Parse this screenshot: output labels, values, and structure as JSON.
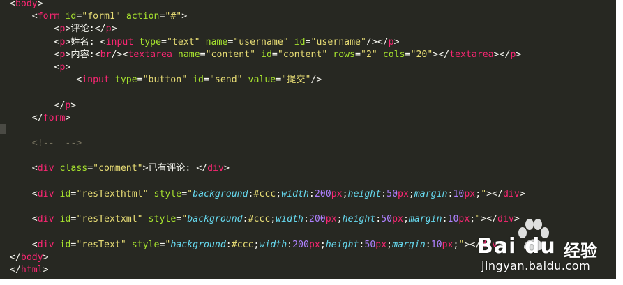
{
  "code_lines": [
    [
      {
        "t": "br",
        "v": "<"
      },
      {
        "t": "tag",
        "v": "body"
      },
      {
        "t": "br",
        "v": ">"
      }
    ],
    [
      {
        "t": "txt",
        "v": "    "
      },
      {
        "t": "br",
        "v": "<"
      },
      {
        "t": "tag",
        "v": "form"
      },
      {
        "t": "txt",
        "v": " "
      },
      {
        "t": "attr",
        "v": "id"
      },
      {
        "t": "txt",
        "v": "="
      },
      {
        "t": "str",
        "v": "\"form1\""
      },
      {
        "t": "txt",
        "v": " "
      },
      {
        "t": "attr",
        "v": "action"
      },
      {
        "t": "txt",
        "v": "="
      },
      {
        "t": "str",
        "v": "\"#\""
      },
      {
        "t": "br",
        "v": ">"
      }
    ],
    [
      {
        "t": "txt",
        "v": "        "
      },
      {
        "t": "br",
        "v": "<"
      },
      {
        "t": "tag",
        "v": "p"
      },
      {
        "t": "br",
        "v": ">"
      },
      {
        "t": "txt",
        "v": "评论:"
      },
      {
        "t": "br",
        "v": "</"
      },
      {
        "t": "tag",
        "v": "p"
      },
      {
        "t": "br",
        "v": ">"
      }
    ],
    [
      {
        "t": "txt",
        "v": "        "
      },
      {
        "t": "br",
        "v": "<"
      },
      {
        "t": "tag",
        "v": "p"
      },
      {
        "t": "br",
        "v": ">"
      },
      {
        "t": "txt",
        "v": "姓名: "
      },
      {
        "t": "br",
        "v": "<"
      },
      {
        "t": "tag",
        "v": "input"
      },
      {
        "t": "txt",
        "v": " "
      },
      {
        "t": "attr",
        "v": "type"
      },
      {
        "t": "txt",
        "v": "="
      },
      {
        "t": "str",
        "v": "\"text\""
      },
      {
        "t": "txt",
        "v": " "
      },
      {
        "t": "attr",
        "v": "name"
      },
      {
        "t": "txt",
        "v": "="
      },
      {
        "t": "str",
        "v": "\"username\""
      },
      {
        "t": "txt",
        "v": " "
      },
      {
        "t": "attr",
        "v": "id"
      },
      {
        "t": "txt",
        "v": "="
      },
      {
        "t": "str",
        "v": "\"username\""
      },
      {
        "t": "br",
        "v": "/></"
      },
      {
        "t": "tag",
        "v": "p"
      },
      {
        "t": "br",
        "v": ">"
      }
    ],
    [
      {
        "t": "txt",
        "v": "        "
      },
      {
        "t": "br",
        "v": "<"
      },
      {
        "t": "tag",
        "v": "p"
      },
      {
        "t": "br",
        "v": ">"
      },
      {
        "t": "txt",
        "v": "内容:"
      },
      {
        "t": "br",
        "v": "<"
      },
      {
        "t": "tag",
        "v": "br"
      },
      {
        "t": "br",
        "v": "/><"
      },
      {
        "t": "tag",
        "v": "textarea"
      },
      {
        "t": "txt",
        "v": " "
      },
      {
        "t": "attr",
        "v": "name"
      },
      {
        "t": "txt",
        "v": "="
      },
      {
        "t": "str",
        "v": "\"content\""
      },
      {
        "t": "txt",
        "v": " "
      },
      {
        "t": "attr",
        "v": "id"
      },
      {
        "t": "txt",
        "v": "="
      },
      {
        "t": "str",
        "v": "\"content\""
      },
      {
        "t": "txt",
        "v": " "
      },
      {
        "t": "attr",
        "v": "rows"
      },
      {
        "t": "txt",
        "v": "="
      },
      {
        "t": "str",
        "v": "\"2\""
      },
      {
        "t": "txt",
        "v": " "
      },
      {
        "t": "attr",
        "v": "cols"
      },
      {
        "t": "txt",
        "v": "="
      },
      {
        "t": "str",
        "v": "\"20\""
      },
      {
        "t": "br",
        "v": "></"
      },
      {
        "t": "tag",
        "v": "textarea"
      },
      {
        "t": "br",
        "v": "></"
      },
      {
        "t": "tag",
        "v": "p"
      },
      {
        "t": "br",
        "v": ">"
      }
    ],
    [
      {
        "t": "txt",
        "v": "        "
      },
      {
        "t": "br",
        "v": "<"
      },
      {
        "t": "tag",
        "v": "p"
      },
      {
        "t": "br",
        "v": ">"
      }
    ],
    [
      {
        "t": "txt",
        "v": "            "
      },
      {
        "t": "br",
        "v": "<"
      },
      {
        "t": "tag",
        "v": "input"
      },
      {
        "t": "txt",
        "v": " "
      },
      {
        "t": "attr",
        "v": "type"
      },
      {
        "t": "txt",
        "v": "="
      },
      {
        "t": "str",
        "v": "\"button\""
      },
      {
        "t": "txt",
        "v": " "
      },
      {
        "t": "attr",
        "v": "id"
      },
      {
        "t": "txt",
        "v": "="
      },
      {
        "t": "str",
        "v": "\"send\""
      },
      {
        "t": "txt",
        "v": " "
      },
      {
        "t": "attr",
        "v": "value"
      },
      {
        "t": "txt",
        "v": "="
      },
      {
        "t": "str",
        "v": "\"提交\""
      },
      {
        "t": "br",
        "v": "/>"
      }
    ],
    [],
    [
      {
        "t": "txt",
        "v": "        "
      },
      {
        "t": "br",
        "v": "</"
      },
      {
        "t": "tag",
        "v": "p"
      },
      {
        "t": "br",
        "v": ">"
      }
    ],
    [
      {
        "t": "txt",
        "v": "    "
      },
      {
        "t": "br",
        "v": "</"
      },
      {
        "t": "tag",
        "v": "form"
      },
      {
        "t": "br",
        "v": ">"
      }
    ],
    [],
    [
      {
        "t": "txt",
        "v": "    "
      },
      {
        "t": "cmt",
        "v": "<!--  -->"
      }
    ],
    [],
    [
      {
        "t": "txt",
        "v": "    "
      },
      {
        "t": "br",
        "v": "<"
      },
      {
        "t": "tag",
        "v": "div"
      },
      {
        "t": "txt",
        "v": " "
      },
      {
        "t": "attr",
        "v": "class"
      },
      {
        "t": "txt",
        "v": "="
      },
      {
        "t": "str",
        "v": "\"comment\""
      },
      {
        "t": "br",
        "v": ">"
      },
      {
        "t": "txt",
        "v": "已有评论: "
      },
      {
        "t": "br",
        "v": "</"
      },
      {
        "t": "tag",
        "v": "div"
      },
      {
        "t": "br",
        "v": ">"
      }
    ],
    [],
    [
      {
        "t": "txt",
        "v": "    "
      },
      {
        "t": "br",
        "v": "<"
      },
      {
        "t": "tag",
        "v": "div"
      },
      {
        "t": "txt",
        "v": " "
      },
      {
        "t": "attr",
        "v": "id"
      },
      {
        "t": "txt",
        "v": "="
      },
      {
        "t": "str",
        "v": "\"resTexthtml\""
      },
      {
        "t": "txt",
        "v": " "
      },
      {
        "t": "attr",
        "v": "style"
      },
      {
        "t": "txt",
        "v": "="
      },
      {
        "t": "str",
        "v": "\""
      },
      {
        "t": "prop",
        "v": "background"
      },
      {
        "t": "txt",
        "v": ":"
      },
      {
        "t": "str",
        "v": "#ccc"
      },
      {
        "t": "txt",
        "v": ";"
      },
      {
        "t": "prop",
        "v": "width"
      },
      {
        "t": "txt",
        "v": ":"
      },
      {
        "t": "num",
        "v": "200"
      },
      {
        "t": "tag",
        "v": "px"
      },
      {
        "t": "txt",
        "v": ";"
      },
      {
        "t": "prop",
        "v": "height"
      },
      {
        "t": "txt",
        "v": ":"
      },
      {
        "t": "num",
        "v": "50"
      },
      {
        "t": "tag",
        "v": "px"
      },
      {
        "t": "txt",
        "v": ";"
      },
      {
        "t": "prop",
        "v": "margin"
      },
      {
        "t": "txt",
        "v": ":"
      },
      {
        "t": "num",
        "v": "10"
      },
      {
        "t": "tag",
        "v": "px"
      },
      {
        "t": "txt",
        "v": ";"
      },
      {
        "t": "str",
        "v": "\""
      },
      {
        "t": "br",
        "v": "></"
      },
      {
        "t": "tag",
        "v": "div"
      },
      {
        "t": "br",
        "v": ">"
      }
    ],
    [],
    [
      {
        "t": "txt",
        "v": "    "
      },
      {
        "t": "br",
        "v": "<"
      },
      {
        "t": "tag",
        "v": "div"
      },
      {
        "t": "txt",
        "v": " "
      },
      {
        "t": "attr",
        "v": "id"
      },
      {
        "t": "txt",
        "v": "="
      },
      {
        "t": "str",
        "v": "\"resTextxml\""
      },
      {
        "t": "txt",
        "v": " "
      },
      {
        "t": "attr",
        "v": "style"
      },
      {
        "t": "txt",
        "v": "="
      },
      {
        "t": "str",
        "v": "\""
      },
      {
        "t": "prop",
        "v": "background"
      },
      {
        "t": "txt",
        "v": ":"
      },
      {
        "t": "str",
        "v": "#ccc"
      },
      {
        "t": "txt",
        "v": ";"
      },
      {
        "t": "prop",
        "v": "width"
      },
      {
        "t": "txt",
        "v": ":"
      },
      {
        "t": "num",
        "v": "200"
      },
      {
        "t": "tag",
        "v": "px"
      },
      {
        "t": "txt",
        "v": ";"
      },
      {
        "t": "prop",
        "v": "height"
      },
      {
        "t": "txt",
        "v": ":"
      },
      {
        "t": "num",
        "v": "50"
      },
      {
        "t": "tag",
        "v": "px"
      },
      {
        "t": "txt",
        "v": ";"
      },
      {
        "t": "prop",
        "v": "margin"
      },
      {
        "t": "txt",
        "v": ":"
      },
      {
        "t": "num",
        "v": "10"
      },
      {
        "t": "tag",
        "v": "px"
      },
      {
        "t": "txt",
        "v": ";"
      },
      {
        "t": "str",
        "v": "\""
      },
      {
        "t": "br",
        "v": "></"
      },
      {
        "t": "tag",
        "v": "div"
      },
      {
        "t": "br",
        "v": ">"
      }
    ],
    [],
    [
      {
        "t": "txt",
        "v": "    "
      },
      {
        "t": "br",
        "v": "<"
      },
      {
        "t": "tag",
        "v": "div"
      },
      {
        "t": "txt",
        "v": " "
      },
      {
        "t": "attr",
        "v": "id"
      },
      {
        "t": "txt",
        "v": "="
      },
      {
        "t": "str",
        "v": "\"resText\""
      },
      {
        "t": "txt",
        "v": " "
      },
      {
        "t": "attr",
        "v": "style"
      },
      {
        "t": "txt",
        "v": "="
      },
      {
        "t": "str",
        "v": "\""
      },
      {
        "t": "prop",
        "v": "background"
      },
      {
        "t": "txt",
        "v": ":"
      },
      {
        "t": "str",
        "v": "#ccc"
      },
      {
        "t": "txt",
        "v": ";"
      },
      {
        "t": "prop",
        "v": "width"
      },
      {
        "t": "txt",
        "v": ":"
      },
      {
        "t": "num",
        "v": "200"
      },
      {
        "t": "tag",
        "v": "px"
      },
      {
        "t": "txt",
        "v": ";"
      },
      {
        "t": "prop",
        "v": "height"
      },
      {
        "t": "txt",
        "v": ":"
      },
      {
        "t": "num",
        "v": "50"
      },
      {
        "t": "tag",
        "v": "px"
      },
      {
        "t": "txt",
        "v": ";"
      },
      {
        "t": "prop",
        "v": "margin"
      },
      {
        "t": "txt",
        "v": ":"
      },
      {
        "t": "num",
        "v": "10"
      },
      {
        "t": "tag",
        "v": "px"
      },
      {
        "t": "txt",
        "v": ";"
      },
      {
        "t": "str",
        "v": "\""
      },
      {
        "t": "br",
        "v": "></"
      },
      {
        "t": "tag",
        "v": "div"
      },
      {
        "t": "br",
        "v": ">"
      }
    ],
    [
      {
        "t": "br",
        "v": "</"
      },
      {
        "t": "tag",
        "v": "body"
      },
      {
        "t": "br",
        "v": ">"
      }
    ],
    [
      {
        "t": "br",
        "v": "</"
      },
      {
        "t": "tag",
        "v": "html"
      },
      {
        "t": "br",
        "v": ">"
      }
    ]
  ],
  "watermark": {
    "brand": "Bai du",
    "brand_cn": "经验",
    "url": "jingyan.baidu.com"
  },
  "colors": {
    "editor_bg": "#272822",
    "tag": "#f92672",
    "attribute": "#a6e22e",
    "string": "#e6db74",
    "comment": "#75715e",
    "css_property": "#66d9ef",
    "number": "#ae81ff"
  }
}
